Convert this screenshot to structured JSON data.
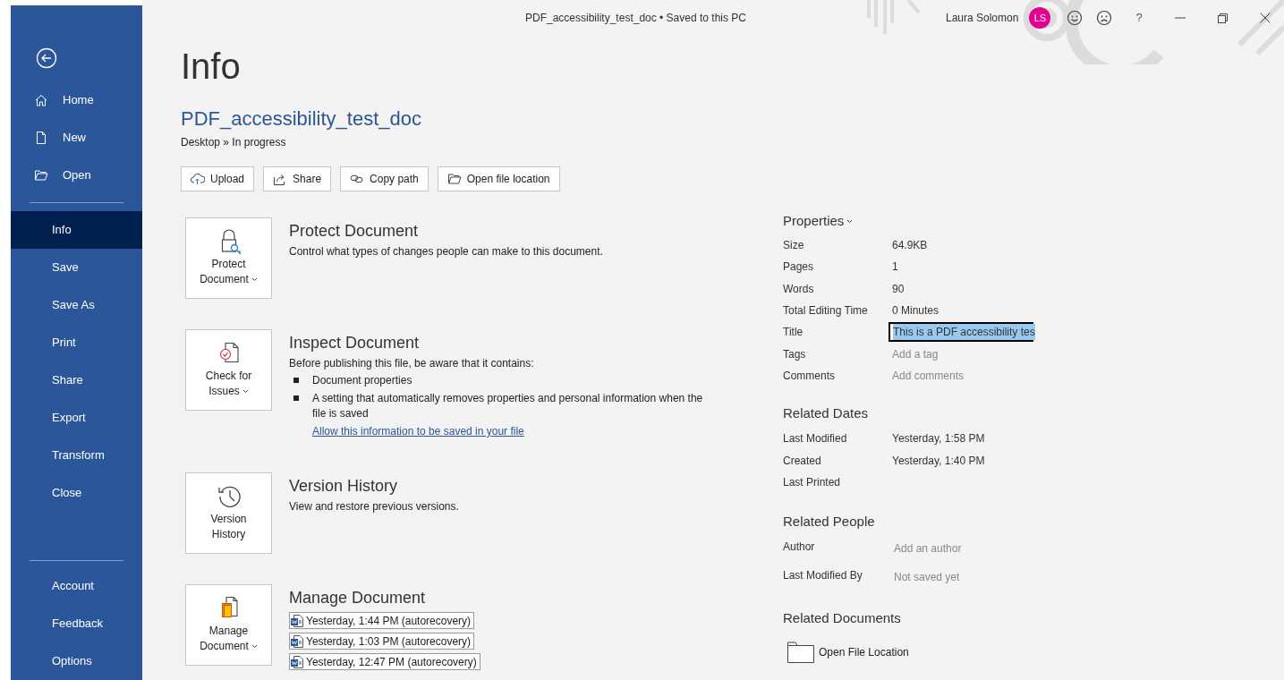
{
  "window": {
    "title": "PDF_accessibility_test_doc • Saved to this PC",
    "user": "Laura Solomon",
    "avatar_initials": "LS",
    "help": "?"
  },
  "sidebar": {
    "top_items": [
      {
        "label": "Home",
        "kind": "home",
        "selected": false
      },
      {
        "label": "New",
        "kind": "new",
        "selected": false
      },
      {
        "label": "Open",
        "kind": "open",
        "selected": false
      }
    ],
    "items": [
      {
        "label": "Info",
        "selected": true
      },
      {
        "label": "Save",
        "selected": false
      },
      {
        "label": "Save As",
        "selected": false
      },
      {
        "label": "Print",
        "selected": false
      },
      {
        "label": "Share",
        "selected": false
      },
      {
        "label": "Export",
        "selected": false
      },
      {
        "label": "Transform",
        "selected": false
      },
      {
        "label": "Close",
        "selected": false
      }
    ],
    "bottom_items": [
      {
        "label": "Account",
        "selected": false
      },
      {
        "label": "Feedback",
        "selected": false
      },
      {
        "label": "Options",
        "selected": false
      }
    ]
  },
  "page_title": "Info",
  "document": {
    "name": "PDF_accessibility_test_doc",
    "path": "Desktop » In progress"
  },
  "actions": [
    {
      "label": "Upload",
      "kind": "upload"
    },
    {
      "label": "Share",
      "kind": "share"
    },
    {
      "label": "Copy path",
      "kind": "link"
    },
    {
      "label": "Open file location",
      "kind": "folder"
    }
  ],
  "sections": [
    {
      "kind": "protect",
      "title": "Protect Document",
      "button": {
        "label": "Protect Document",
        "dropdown": true
      },
      "description": "Control what types of changes people can make to this document."
    },
    {
      "kind": "inspect",
      "title": "Inspect Document",
      "button": {
        "label": "Check for Issues",
        "dropdown": true
      },
      "description": "Before publishing this file, be aware that it contains:",
      "bullets": [
        "Document properties",
        "A setting that automatically removes properties and personal information when the file is saved"
      ],
      "link": "Allow this information to be saved in your file"
    },
    {
      "kind": "versions",
      "title": "Version History",
      "button": {
        "label": "Version History",
        "dropdown": false
      },
      "description": "View and restore previous versions."
    },
    {
      "kind": "manage",
      "title": "Manage Document",
      "button": {
        "label": "Manage Document",
        "dropdown": true
      },
      "files": [
        "Yesterday, 1:44 PM (autorecovery)",
        "Yesterday, 1:03 PM (autorecovery)",
        "Yesterday, 12:47 PM (autorecovery)"
      ]
    }
  ],
  "properties": [
    {
      "heading": "Properties",
      "dropdown": true,
      "rows": [
        {
          "label": "Size",
          "value": "64.9KB",
          "kind": "text"
        },
        {
          "label": "Pages",
          "value": "1",
          "kind": "text"
        },
        {
          "label": "Words",
          "value": "90",
          "kind": "text"
        },
        {
          "label": "Total Editing Time",
          "value": "0 Minutes",
          "kind": "text"
        },
        {
          "label": "Title",
          "value": "This is a PDF accessibility tes",
          "kind": "field",
          "highlighted": true
        },
        {
          "label": "Tags",
          "value": "Add a tag",
          "kind": "placeholder"
        },
        {
          "label": "Comments",
          "value": "Add comments",
          "kind": "placeholder"
        }
      ]
    },
    {
      "heading": "Related Dates",
      "dropdown": false,
      "rows": [
        {
          "label": "Last Modified",
          "value": "Yesterday, 1:58 PM",
          "kind": "text"
        },
        {
          "label": "Created",
          "value": "Yesterday, 1:40 PM",
          "kind": "text"
        },
        {
          "label": "Last Printed"
        }
      ]
    },
    {
      "heading": "Related People",
      "dropdown": false,
      "rows": [
        {
          "label": "Author",
          "value": "Add an author",
          "kind": "placeholder"
        },
        {
          "label": "Last Modified By",
          "value": "Not saved yet",
          "kind": "placeholder"
        }
      ]
    },
    {
      "heading": "Related Documents",
      "dropdown": false,
      "links": [
        "Open File Location"
      ]
    }
  ]
}
